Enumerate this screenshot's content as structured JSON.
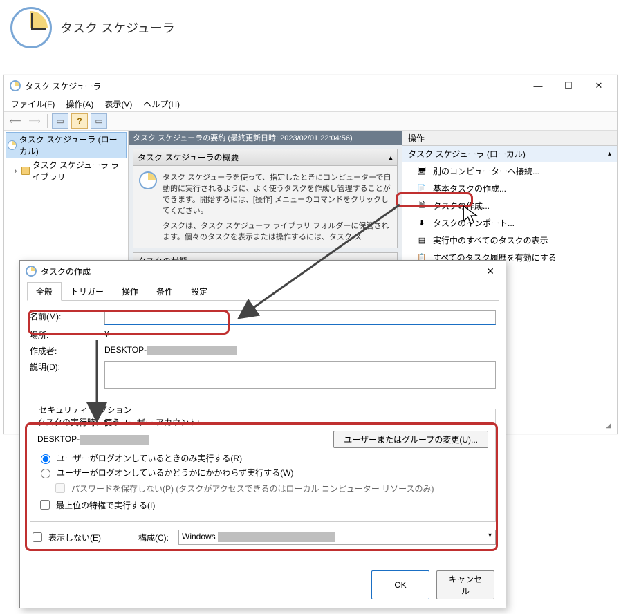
{
  "header": {
    "title": "タスク スケジューラ"
  },
  "window": {
    "title": "タスク スケジューラ",
    "menu": {
      "file": "ファイル(F)",
      "action": "操作(A)",
      "view": "表示(V)",
      "help": "ヘルプ(H)"
    },
    "tree": {
      "root": "タスク スケジューラ (ローカル)",
      "child": "タスク スケジューラ ライブラリ"
    },
    "center": {
      "summary_header": "タスク スケジューラの要約 (最終更新日時: 2023/02/01 22:04:56)",
      "overview_title": "タスク スケジューラの概要",
      "overview_body1": "タスク スケジューラを使って、指定したときにコンピューターで自動的に実行されるように、よく使うタスクを作成し管理することができます。開始するには、[操作] メニューのコマンドをクリックしてください。",
      "overview_body2": "タスクは、タスク スケジューラ ライブラリ フォルダーに保管されます。個々のタスクを表示または操作するには、タスク ス",
      "status_title": "タスクの状態"
    },
    "actions": {
      "header": "操作",
      "subheader": "タスク スケジューラ (ローカル)",
      "items": [
        "別のコンピューターへ接続...",
        "基本タスクの作成...",
        "タスクの作成...",
        "タスクのインポート...",
        "実行中のすべてのタスクの表示",
        "すべてのタスク履歴を有効にする"
      ]
    }
  },
  "dialog": {
    "title": "タスクの作成",
    "tabs": [
      "全般",
      "トリガー",
      "操作",
      "条件",
      "設定"
    ],
    "labels": {
      "name": "名前(M):",
      "location": "場所:",
      "author": "作成者:",
      "description": "説明(D):"
    },
    "values": {
      "name": "",
      "location": "¥",
      "author_prefix": "DESKTOP-"
    },
    "security": {
      "group_title": "セキュリティ オプション",
      "account_label": "タスクの実行時に使うユーザー アカウント:",
      "account_prefix": "DESKTOP-",
      "change_btn": "ユーザーまたはグループの変更(U)...",
      "radio_logon": "ユーザーがログオンしているときのみ実行する(R)",
      "radio_any": "ユーザーがログオンしているかどうかにかかわらず実行する(W)",
      "check_nopass": "パスワードを保存しない(P) (タスクがアクセスできるのはローカル コンピューター リソースのみ)",
      "check_highest": "最上位の特権で実行する(I)"
    },
    "bottom": {
      "check_hidden": "表示しない(E)",
      "config_label": "構成(C):",
      "config_value": "Windows"
    },
    "buttons": {
      "ok": "OK",
      "cancel": "キャンセル"
    }
  }
}
